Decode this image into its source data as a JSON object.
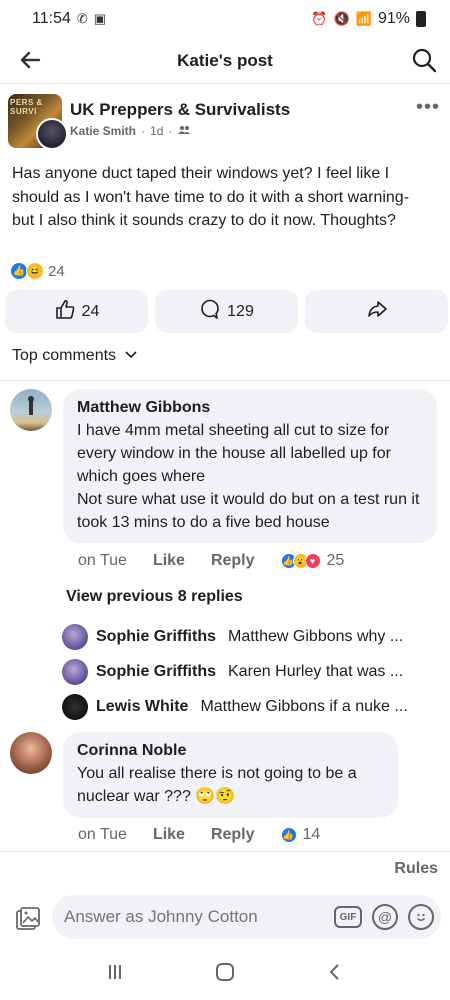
{
  "status_bar": {
    "time": "11:54",
    "battery": "91%"
  },
  "app_bar": {
    "title": "Katie's post"
  },
  "post": {
    "group_name": "UK Preppers & Survivalists",
    "group_logo_text": "PERS & SURVI",
    "author": "Katie Smith",
    "time": "1d",
    "separator": "·",
    "text": "Has anyone duct taped their windows yet? I feel like I should as I won't have time to do it with a short warning- but I also think it sounds crazy to do it now. Thoughts?",
    "reaction_count": "24",
    "like_count": "24",
    "comment_count": "129"
  },
  "comments_section": {
    "sort_label": "Top comments"
  },
  "comments": [
    {
      "name": "Matthew Gibbons",
      "text": "I have 4mm metal sheeting all cut to size for every window in the house all labelled up for which goes where\nNot sure what use it would do but on a test run it took 13 mins to do a five bed house",
      "time": "on Tue",
      "like_label": "Like",
      "reply_label": "Reply",
      "reaction_count": "25"
    },
    {
      "name": "Corinna Noble",
      "text": "You all realise there is not going to be a nuclear war ??? 🙄🤨",
      "time": "on Tue",
      "like_label": "Like",
      "reply_label": "Reply",
      "reaction_count": "14"
    }
  ],
  "view_previous": "View previous 8 replies",
  "replies": [
    {
      "name": "Sophie Griffiths",
      "text": "Matthew Gibbons why ..."
    },
    {
      "name": "Sophie Griffiths",
      "text": "Karen Hurley that was ..."
    },
    {
      "name": "Lewis White",
      "text": "Matthew Gibbons if a nuke ..."
    }
  ],
  "rules_label": "Rules",
  "composer": {
    "placeholder": "Answer as Johnny Cotton",
    "gif_label": "GIF"
  },
  "colors": {
    "accent": "#1877f2",
    "bubble": "#f0f2f5",
    "secondary_text": "#65676b"
  }
}
